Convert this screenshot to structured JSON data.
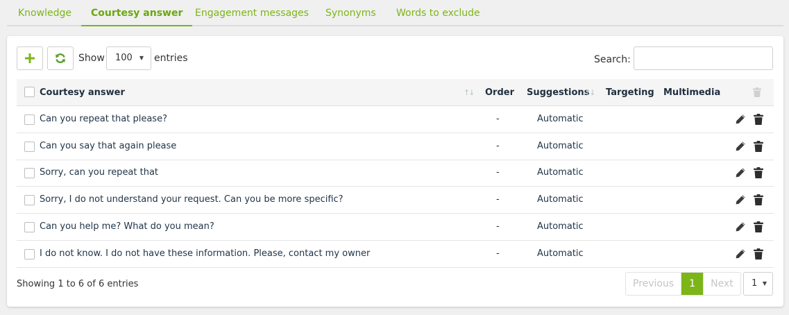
{
  "tabs": [
    {
      "label": "Knowledge",
      "active": false
    },
    {
      "label": "Courtesy answer",
      "active": true
    },
    {
      "label": "Engagement messages",
      "active": false
    },
    {
      "label": "Synonyms",
      "active": false
    },
    {
      "label": "Words to exclude",
      "active": false
    }
  ],
  "toolbar": {
    "show_label": "Show",
    "page_size": "100",
    "entries_label": "entries",
    "search_label": "Search:",
    "search_value": "",
    "search_placeholder": ""
  },
  "table": {
    "columns": {
      "answer": "Courtesy answer",
      "order": "Order",
      "suggestions": "Suggestions",
      "targeting": "Targeting",
      "multimedia": "Multimedia"
    },
    "rows": [
      {
        "answer": "Can you repeat that please?",
        "order": "-",
        "suggestions": "Automatic",
        "targeting": "",
        "multimedia": ""
      },
      {
        "answer": "Can you say that again please",
        "order": "-",
        "suggestions": "Automatic",
        "targeting": "",
        "multimedia": ""
      },
      {
        "answer": "Sorry, can you repeat that",
        "order": "-",
        "suggestions": "Automatic",
        "targeting": "",
        "multimedia": ""
      },
      {
        "answer": "Sorry, I do not understand your request. Can you be more specific?",
        "order": "-",
        "suggestions": "Automatic",
        "targeting": "",
        "multimedia": ""
      },
      {
        "answer": "Can you help me? What do you mean?",
        "order": "-",
        "suggestions": "Automatic",
        "targeting": "",
        "multimedia": ""
      },
      {
        "answer": "I do not know. I do not have these information. Please, contact my owner",
        "order": "-",
        "suggestions": "Automatic",
        "targeting": "",
        "multimedia": ""
      }
    ]
  },
  "footer": {
    "info": "Showing 1 to 6 of 6 entries",
    "previous": "Previous",
    "current_page": "1",
    "next": "Next",
    "page_select": "1"
  },
  "colors": {
    "accent": "#7cb518",
    "refresh_icon": "#5aa02c",
    "header_text": "#1f2f3f",
    "icon_dark": "#3a3a3a",
    "disabled_icon": "#d0d0d0"
  },
  "icons": {
    "add": "plus-icon",
    "refresh": "refresh-icon",
    "edit": "pencil-icon",
    "delete": "trash-icon",
    "sort": "sort-icon",
    "caret": "caret-down-icon"
  }
}
